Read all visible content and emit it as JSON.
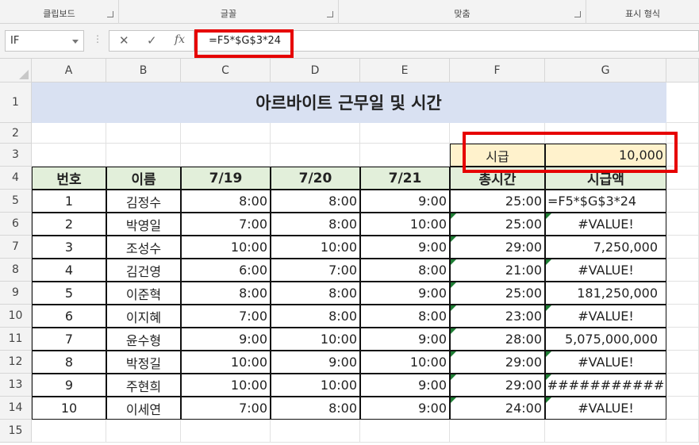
{
  "ribbon": {
    "groups": [
      "클립보드",
      "글꼴",
      "맞춤",
      "표시 형식"
    ]
  },
  "formula_bar": {
    "name_box": "IF",
    "cancel_icon": "✕",
    "enter_icon": "✓",
    "fx_icon": "fx",
    "formula": "=F5*$G$3*24"
  },
  "columns": [
    "A",
    "B",
    "C",
    "D",
    "E",
    "F",
    "G"
  ],
  "rows": [
    "1",
    "2",
    "3",
    "4",
    "5",
    "6",
    "7",
    "8",
    "9",
    "10",
    "11",
    "12",
    "13",
    "14",
    "15"
  ],
  "sheet": {
    "title": "아르바이트 근무일 및 시간",
    "wage_label": "시급",
    "wage_value": "10,000",
    "headers": [
      "번호",
      "이름",
      "7/19",
      "7/20",
      "7/21",
      "총시간",
      "시급액"
    ],
    "data": [
      [
        "1",
        "김정수",
        "8:00",
        "8:00",
        "9:00",
        "25:00",
        "=F5*$G$3*24"
      ],
      [
        "2",
        "박영일",
        "7:00",
        "8:00",
        "10:00",
        "25:00",
        "#VALUE!"
      ],
      [
        "3",
        "조성수",
        "10:00",
        "10:00",
        "9:00",
        "29:00",
        "7,250,000"
      ],
      [
        "4",
        "김건영",
        "6:00",
        "7:00",
        "8:00",
        "21:00",
        "#VALUE!"
      ],
      [
        "5",
        "이준혁",
        "8:00",
        "8:00",
        "9:00",
        "25:00",
        "181,250,000"
      ],
      [
        "6",
        "이지혜",
        "7:00",
        "8:00",
        "8:00",
        "23:00",
        "#VALUE!"
      ],
      [
        "7",
        "윤수형",
        "9:00",
        "10:00",
        "9:00",
        "28:00",
        "5,075,000,000"
      ],
      [
        "8",
        "박정길",
        "10:00",
        "9:00",
        "10:00",
        "29:00",
        "#VALUE!"
      ],
      [
        "9",
        "주현희",
        "10:00",
        "10:00",
        "9:00",
        "29:00",
        "###########"
      ],
      [
        "10",
        "이세연",
        "7:00",
        "8:00",
        "9:00",
        "24:00",
        "#VALUE!"
      ]
    ]
  },
  "colors": {
    "title_fill": "#d9e1f2",
    "header_fill": "#e2efda",
    "wage_fill": "#fff2cc",
    "highlight": "#e60000",
    "error_indicator": "#1e7e34"
  }
}
